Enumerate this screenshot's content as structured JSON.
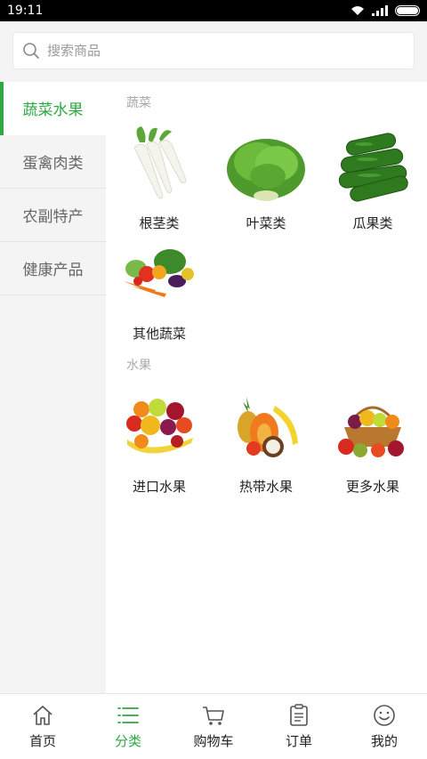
{
  "status_bar": {
    "time": "19:11"
  },
  "search": {
    "placeholder": "搜索商品"
  },
  "sidebar": {
    "items": [
      {
        "label": "蔬菜水果",
        "active": true
      },
      {
        "label": "蛋禽肉类",
        "active": false
      },
      {
        "label": "农副特产",
        "active": false
      },
      {
        "label": "健康产品",
        "active": false
      }
    ]
  },
  "sections": [
    {
      "title": "蔬菜",
      "items": [
        {
          "label": "根茎类",
          "icon": "radish-image"
        },
        {
          "label": "叶菜类",
          "icon": "lettuce-image"
        },
        {
          "label": "瓜果类",
          "icon": "cucumber-image"
        },
        {
          "label": "其他蔬菜",
          "icon": "mixed-vegetables-image"
        }
      ]
    },
    {
      "title": "水果",
      "items": [
        {
          "label": "进口水果",
          "icon": "imported-fruits-image"
        },
        {
          "label": "热带水果",
          "icon": "tropical-fruits-image"
        },
        {
          "label": "更多水果",
          "icon": "fruit-basket-image"
        }
      ]
    }
  ],
  "bottom_nav": {
    "items": [
      {
        "label": "首页",
        "icon": "home-icon"
      },
      {
        "label": "分类",
        "icon": "category-icon",
        "active": true
      },
      {
        "label": "购物车",
        "icon": "cart-icon"
      },
      {
        "label": "订单",
        "icon": "order-icon"
      },
      {
        "label": "我的",
        "icon": "smiley-icon"
      }
    ]
  },
  "colors": {
    "accent": "#2fa843",
    "sidebar_bg": "#f4f4f4",
    "text": "#222222",
    "muted": "#aaaaaa"
  }
}
